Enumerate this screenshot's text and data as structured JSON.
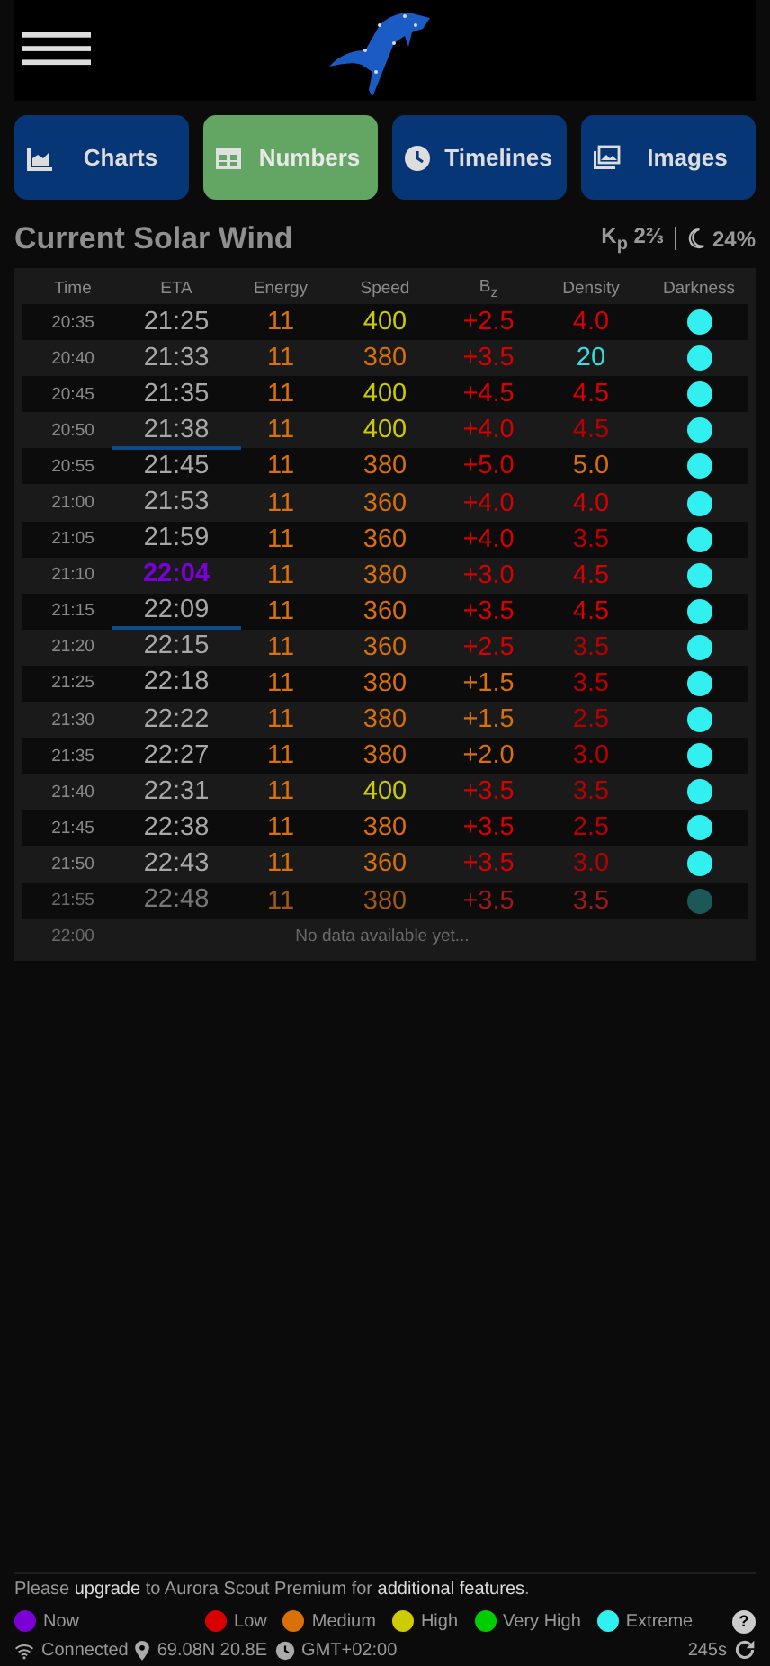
{
  "tabs": [
    {
      "label": "Charts",
      "kind": "chart",
      "selected": false
    },
    {
      "label": "Numbers",
      "kind": "table",
      "selected": true
    },
    {
      "label": "Timelines",
      "kind": "clock",
      "selected": false
    },
    {
      "label": "Images",
      "kind": "images",
      "selected": false
    }
  ],
  "title": "Current Solar Wind",
  "kp": "K$_{p}$ 2⅔",
  "moon": "24%",
  "columns": [
    "Time",
    "ETA",
    "Energy",
    "Speed",
    "B$_{z}$",
    "Density",
    "Darkness"
  ],
  "rows": [
    {
      "time": "20:35",
      "eta": "21:25",
      "now": false,
      "underline": false,
      "faded": false,
      "values": [
        {
          "text": "11",
          "color": "#d97008"
        },
        {
          "text": "400",
          "color": "#cccc00"
        },
        {
          "text": "+2.5",
          "color": "#d80000"
        },
        {
          "text": "4.0",
          "color": "#d80000"
        }
      ],
      "color": "#33f0f0"
    },
    {
      "time": "20:40",
      "eta": "21:33",
      "now": false,
      "underline": false,
      "faded": false,
      "values": [
        {
          "text": "11",
          "color": "#d97008"
        },
        {
          "text": "380",
          "color": "#d97008"
        },
        {
          "text": "+3.5",
          "color": "#d80000"
        },
        {
          "text": "20",
          "color": "#33e0e0"
        }
      ],
      "color": "#33f0f0"
    },
    {
      "time": "20:45",
      "eta": "21:35",
      "now": false,
      "underline": false,
      "faded": false,
      "values": [
        {
          "text": "11",
          "color": "#d97008"
        },
        {
          "text": "400",
          "color": "#cccc00"
        },
        {
          "text": "+4.5",
          "color": "#d80000"
        },
        {
          "text": "4.5",
          "color": "#d80000"
        }
      ],
      "color": "#33f0f0"
    },
    {
      "time": "20:50",
      "eta": "21:38",
      "now": false,
      "underline": true,
      "faded": false,
      "values": [
        {
          "text": "11",
          "color": "#d97008"
        },
        {
          "text": "400",
          "color": "#cccc00"
        },
        {
          "text": "+4.0",
          "color": "#d80000"
        },
        {
          "text": "4.5",
          "color": "#b80000"
        }
      ],
      "color": "#33f0f0"
    },
    {
      "time": "20:55",
      "eta": "21:45",
      "now": false,
      "underline": false,
      "faded": false,
      "values": [
        {
          "text": "11",
          "color": "#d97008"
        },
        {
          "text": "380",
          "color": "#d97008"
        },
        {
          "text": "+5.0",
          "color": "#d80000"
        },
        {
          "text": "5.0",
          "color": "#d97008"
        }
      ],
      "color": "#33f0f0"
    },
    {
      "time": "21:00",
      "eta": "21:53",
      "now": false,
      "underline": false,
      "faded": false,
      "values": [
        {
          "text": "11",
          "color": "#d97008"
        },
        {
          "text": "360",
          "color": "#d97008"
        },
        {
          "text": "+4.0",
          "color": "#d80000"
        },
        {
          "text": "4.0",
          "color": "#d80000"
        }
      ],
      "color": "#33f0f0"
    },
    {
      "time": "21:05",
      "eta": "21:59",
      "now": false,
      "underline": false,
      "faded": false,
      "values": [
        {
          "text": "11",
          "color": "#d97008"
        },
        {
          "text": "360",
          "color": "#d97008"
        },
        {
          "text": "+4.0",
          "color": "#d80000"
        },
        {
          "text": "3.5",
          "color": "#b80000"
        }
      ],
      "color": "#33f0f0"
    },
    {
      "time": "21:10",
      "eta": "22:04",
      "now": true,
      "underline": false,
      "faded": false,
      "values": [
        {
          "text": "11",
          "color": "#d97008"
        },
        {
          "text": "380",
          "color": "#d97008"
        },
        {
          "text": "+3.0",
          "color": "#d80000"
        },
        {
          "text": "4.5",
          "color": "#d80000"
        }
      ],
      "color": "#33f0f0"
    },
    {
      "time": "21:15",
      "eta": "22:09",
      "now": false,
      "underline": true,
      "faded": false,
      "values": [
        {
          "text": "11",
          "color": "#d97008"
        },
        {
          "text": "360",
          "color": "#d97008"
        },
        {
          "text": "+3.5",
          "color": "#d80000"
        },
        {
          "text": "4.5",
          "color": "#d80000"
        }
      ],
      "color": "#33f0f0"
    },
    {
      "time": "21:20",
      "eta": "22:15",
      "now": false,
      "underline": false,
      "faded": false,
      "values": [
        {
          "text": "11",
          "color": "#d97008"
        },
        {
          "text": "360",
          "color": "#d97008"
        },
        {
          "text": "+2.5",
          "color": "#d80000"
        },
        {
          "text": "3.5",
          "color": "#b80000"
        }
      ],
      "color": "#33f0f0"
    },
    {
      "time": "21:25",
      "eta": "22:18",
      "now": false,
      "underline": false,
      "faded": false,
      "values": [
        {
          "text": "11",
          "color": "#d97008"
        },
        {
          "text": "380",
          "color": "#d97008"
        },
        {
          "text": "+1.5",
          "color": "#d97008"
        },
        {
          "text": "3.5",
          "color": "#b80000"
        }
      ],
      "color": "#33f0f0"
    },
    {
      "time": "21:30",
      "eta": "22:22",
      "now": false,
      "underline": false,
      "faded": false,
      "values": [
        {
          "text": "11",
          "color": "#d97008"
        },
        {
          "text": "380",
          "color": "#d97008"
        },
        {
          "text": "+1.5",
          "color": "#d97008"
        },
        {
          "text": "2.5",
          "color": "#b80000"
        }
      ],
      "color": "#33f0f0"
    },
    {
      "time": "21:35",
      "eta": "22:27",
      "now": false,
      "underline": false,
      "faded": false,
      "values": [
        {
          "text": "11",
          "color": "#d97008"
        },
        {
          "text": "380",
          "color": "#d97008"
        },
        {
          "text": "+2.0",
          "color": "#d97008"
        },
        {
          "text": "3.0",
          "color": "#b80000"
        }
      ],
      "color": "#33f0f0"
    },
    {
      "time": "21:40",
      "eta": "22:31",
      "now": false,
      "underline": false,
      "faded": false,
      "values": [
        {
          "text": "11",
          "color": "#d97008"
        },
        {
          "text": "400",
          "color": "#cccc00"
        },
        {
          "text": "+3.5",
          "color": "#d80000"
        },
        {
          "text": "3.5",
          "color": "#b80000"
        }
      ],
      "color": "#33f0f0"
    },
    {
      "time": "21:45",
      "eta": "22:38",
      "now": false,
      "underline": false,
      "faded": false,
      "values": [
        {
          "text": "11",
          "color": "#d97008"
        },
        {
          "text": "380",
          "color": "#d97008"
        },
        {
          "text": "+3.5",
          "color": "#d80000"
        },
        {
          "text": "2.5",
          "color": "#b80000"
        }
      ],
      "color": "#33f0f0"
    },
    {
      "time": "21:50",
      "eta": "22:43",
      "now": false,
      "underline": false,
      "faded": false,
      "values": [
        {
          "text": "11",
          "color": "#d97008"
        },
        {
          "text": "360",
          "color": "#d97008"
        },
        {
          "text": "+3.5",
          "color": "#d80000"
        },
        {
          "text": "3.0",
          "color": "#b80000"
        }
      ],
      "color": "#33f0f0"
    },
    {
      "time": "21:55",
      "eta": "22:48",
      "now": false,
      "underline": false,
      "faded": true,
      "values": [
        {
          "text": "11",
          "color": "#a05a10"
        },
        {
          "text": "380",
          "color": "#a05a10"
        },
        {
          "text": "+3.5",
          "color": "#a01818"
        },
        {
          "text": "3.5",
          "color": "#a01818"
        }
      ],
      "color": "#1d5858"
    }
  ],
  "empty_row": {
    "time": "22:00",
    "message": "No data available yet..."
  },
  "notice": "Please **upgrade** to Aurora Scout Premium for **additional features**.",
  "legend": [
    {
      "label": "Now",
      "color": "#7a00d6"
    },
    {
      "label": "Low",
      "color": "#d80000"
    },
    {
      "label": "Medium",
      "color": "#d97008"
    },
    {
      "label": "High",
      "color": "#cccc00"
    },
    {
      "label": "Very High",
      "color": "#00cc00"
    },
    {
      "label": "Extreme",
      "color": "#33f0f0"
    }
  ],
  "help": "?",
  "status": {
    "connection": "Connected",
    "location": "69.08N 20.8E",
    "timezone": "GMT+02:00",
    "refresh": "245s"
  }
}
